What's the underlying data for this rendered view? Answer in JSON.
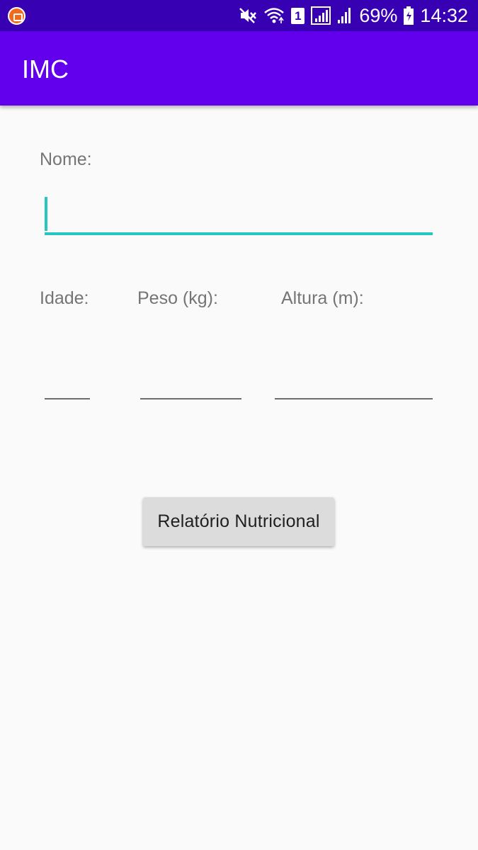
{
  "status_bar": {
    "battery": "69%",
    "time": "14:32",
    "sim_slot": "1",
    "icons": [
      "app-icon",
      "mute-icon",
      "wifi-icon",
      "sim-icon",
      "signal-icon",
      "signal-icon",
      "battery-icon"
    ]
  },
  "app_bar": {
    "title": "IMC"
  },
  "form": {
    "name_label": "Nome:",
    "name_value": "",
    "age_label": "Idade:",
    "age_value": "",
    "weight_label": "Peso (kg):",
    "weight_value": "",
    "height_label": "Altura (m):",
    "height_value": "",
    "submit_label": "Relatório Nutricional"
  },
  "colors": {
    "status_bar": "#3700b3",
    "app_bar": "#6200ee",
    "accent": "#26c6c1",
    "background": "#fafafa",
    "button": "#dcdcdc"
  }
}
